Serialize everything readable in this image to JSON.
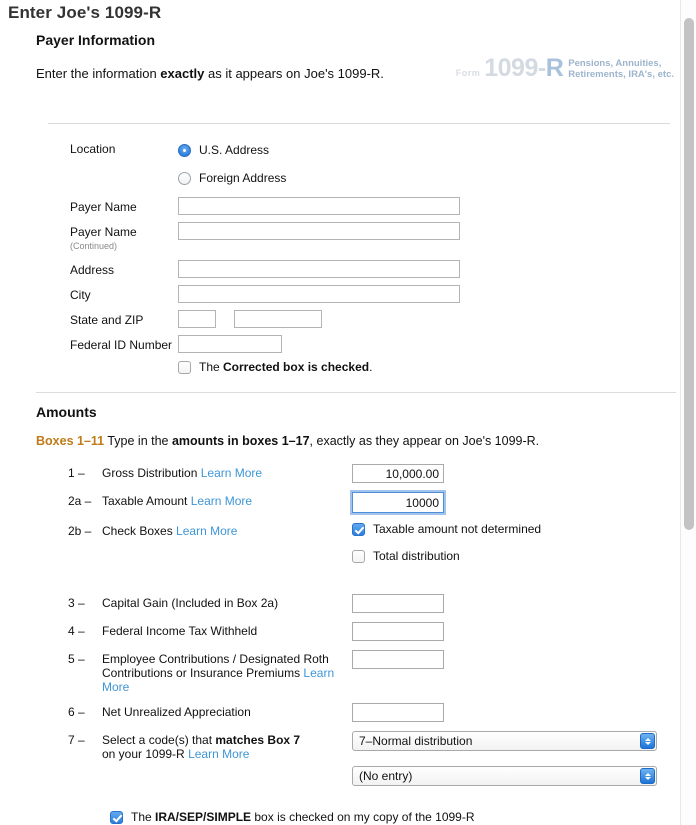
{
  "page": {
    "title": "Enter Joe's 1099-R"
  },
  "payer": {
    "section_title": "Payer Information",
    "intro_prefix": "Enter the information ",
    "intro_bold": "exactly",
    "intro_suffix": " as it appears on Joe's 1099-R.",
    "watermark": {
      "form_label": "Form",
      "number": "1099-",
      "number_suffix": "R",
      "desc_line1": "Pensions, Annuities,",
      "desc_line2": "Retirements, IRA's, etc."
    },
    "location_label": "Location",
    "radio_us": "U.S. Address",
    "radio_foreign": "Foreign Address",
    "radio_selected": "U.S. Address",
    "fields": [
      {
        "label": "Payer Name",
        "sub": "",
        "value": "",
        "width": "wide"
      },
      {
        "label": "Payer Name",
        "sub": "(Continued)",
        "value": "",
        "width": "wide"
      },
      {
        "label": "Address",
        "sub": "",
        "value": "",
        "width": "wide"
      },
      {
        "label": "City",
        "sub": "",
        "value": "",
        "width": "wide"
      }
    ],
    "state_zip_label": "State and ZIP",
    "state_value": "",
    "zip_value": "",
    "federal_id_label": "Federal ID Number",
    "federal_id_value": "",
    "corrected_prefix": "The ",
    "corrected_bold": "Corrected box is checked",
    "corrected_suffix": ".",
    "corrected_checked": false
  },
  "amounts": {
    "section_title": "Amounts",
    "note_tag": "Boxes 1–11",
    "note_prefix": " Type in the ",
    "note_bold": "amounts in boxes 1–17",
    "note_suffix": ", exactly as they appear on Joe's 1099-R.",
    "learn_more": "Learn More",
    "rows": {
      "r1": {
        "num": "1 –",
        "text": "Gross Distribution",
        "value": "10,000.00"
      },
      "r2a": {
        "num": "2a –",
        "text": "Taxable Amount",
        "value": "10000"
      },
      "r2b": {
        "num": "2b –",
        "text": "Check Boxes",
        "cb1_label": "Taxable amount not determined",
        "cb1_checked": true,
        "cb2_label": "Total distribution",
        "cb2_checked": false
      },
      "r3": {
        "num": "3 –",
        "text": "Capital Gain (Included in Box 2a)",
        "value": ""
      },
      "r4": {
        "num": "4 –",
        "text": "Federal Income Tax Withheld",
        "value": ""
      },
      "r5": {
        "num": "5 –",
        "text_line1": "Employee Contributions / Designated Roth",
        "text_line2": "Contributions or Insurance Premiums ",
        "value": ""
      },
      "r6": {
        "num": "6 –",
        "text": "Net Unrealized Appreciation",
        "value": ""
      },
      "r7": {
        "num": "7 –",
        "text_prefix": "Select a code(s) that ",
        "text_bold": "matches Box 7",
        "text_line2": "on your 1099-R ",
        "select1_value": "7–Normal distribution",
        "select2_value": "(No entry)"
      }
    },
    "ira_prefix": "The ",
    "ira_bold": "IRA/SEP/SIMPLE",
    "ira_suffix": " box is checked on my copy of the 1099-R",
    "ira_checked": true
  },
  "colors": {
    "link": "#3e96d6",
    "accent_blue": "#2d7fe0",
    "boxes_tag": "#c07a18"
  }
}
